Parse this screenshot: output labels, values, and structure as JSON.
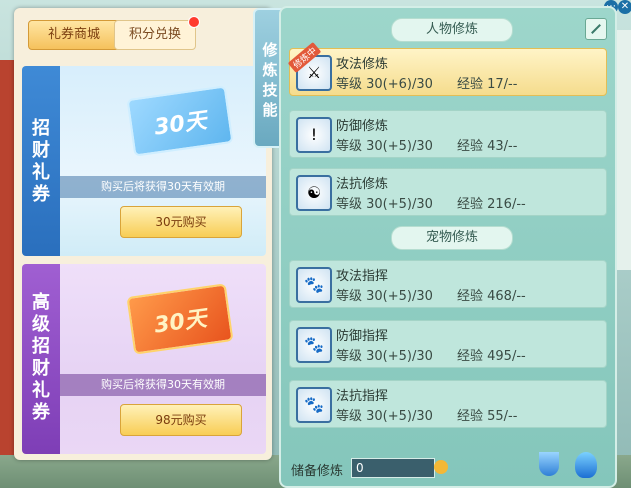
{
  "shop": {
    "tabs": [
      {
        "label": "礼券商城",
        "active": true
      },
      {
        "label": "积分兑换",
        "active": false
      }
    ],
    "cards": [
      {
        "side_title": "招\n财\n礼\n券",
        "ticket_text": "30天",
        "desc": "购买后将获得30天有效期",
        "button": "30元购买",
        "color": "#2a6fbd"
      },
      {
        "side_title": "高\n级\n招\n财\n礼\n券",
        "ticket_text": "30天",
        "desc": "购买后将获得30天有效期",
        "button": "98元购买",
        "color": "#7e3eb6"
      }
    ]
  },
  "vertical_tab": {
    "label": "修\n炼\n技\n能"
  },
  "cultivation": {
    "human_header": "人物修炼",
    "pet_header": "宠物修炼",
    "human_skills": [
      {
        "name": "攻法修炼",
        "level": "等级  30(+6)/30",
        "exp": "经验  17/--",
        "active": true,
        "tag": "修炼中",
        "icon": "attack-magic-icon"
      },
      {
        "name": "防御修炼",
        "level": "等级  30(+5)/30",
        "exp": "经验  43/--",
        "active": false,
        "icon": "defense-icon"
      },
      {
        "name": "法抗修炼",
        "level": "等级  30(+5)/30",
        "exp": "经验  216/--",
        "active": false,
        "icon": "magic-resist-icon"
      }
    ],
    "pet_skills": [
      {
        "name": "攻法指挥",
        "level": "等级  30(+5)/30",
        "exp": "经验  468/--",
        "icon": "pet-attack-icon"
      },
      {
        "name": "防御指挥",
        "level": "等级  30(+5)/30",
        "exp": "经验  495/--",
        "icon": "pet-defense-icon"
      },
      {
        "name": "法抗指挥",
        "level": "等级  30(+5)/30",
        "exp": "经验  55/--",
        "icon": "pet-resist-icon"
      }
    ],
    "reserve_label": "储备修炼",
    "reserve_value": "0"
  }
}
